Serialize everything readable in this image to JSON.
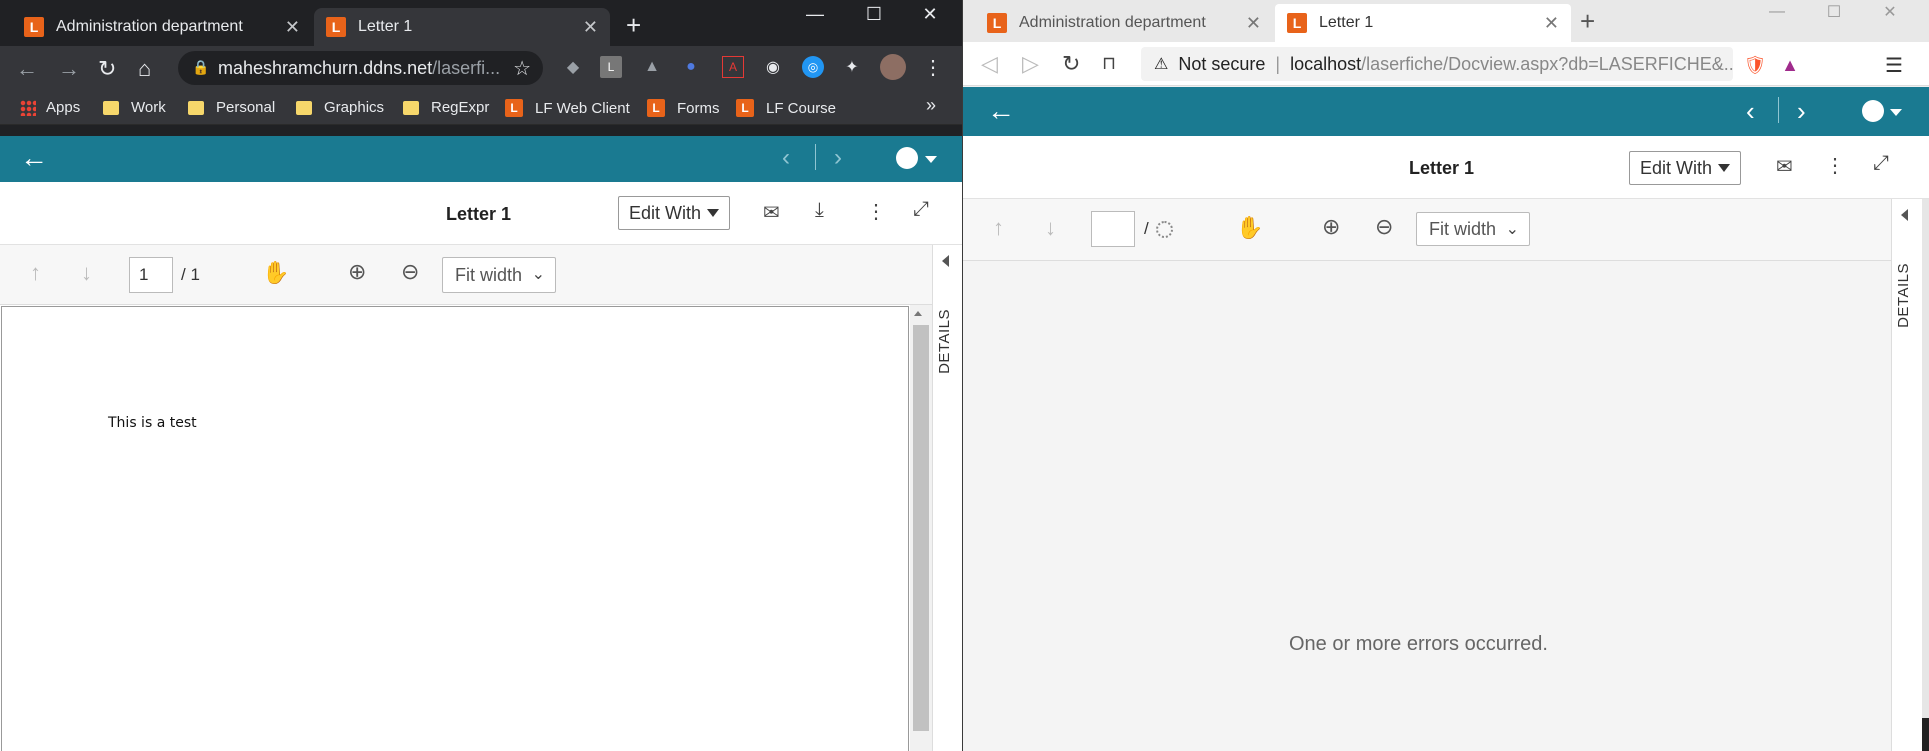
{
  "left_window": {
    "tabs": [
      {
        "title": "Administration department",
        "logo": "L"
      },
      {
        "title": "Letter 1",
        "logo": "L"
      }
    ],
    "window_controls": {
      "minimize": "—",
      "maximize": "☐",
      "close": "✕"
    },
    "url": {
      "host": "maheshramchurn.ddns.net",
      "path": "/laserfi..."
    },
    "bookmarks": [
      {
        "label": "Apps",
        "icon": "apps-grid-icon"
      },
      {
        "label": "Work",
        "icon": "folder-icon"
      },
      {
        "label": "Personal",
        "icon": "folder-icon"
      },
      {
        "label": "Graphics",
        "icon": "folder-icon"
      },
      {
        "label": "RegExpr",
        "icon": "folder-icon"
      },
      {
        "label": "LF Web Client",
        "icon": "laserfiche-icon"
      },
      {
        "label": "Forms",
        "icon": "laserfiche-icon"
      },
      {
        "label": "LF Course",
        "icon": "laserfiche-icon"
      }
    ],
    "bookmarks_overflow": "»",
    "viewer": {
      "title": "Letter 1",
      "edit_with": "Edit With",
      "page_current": "1",
      "page_total": "/ 1",
      "zoom": "Fit width",
      "details_label": "DETAILS",
      "document_text": "This is a test"
    }
  },
  "right_window": {
    "tabs": [
      {
        "title": "Administration department",
        "logo": "L"
      },
      {
        "title": "Letter 1",
        "logo": "L"
      }
    ],
    "window_controls": {
      "minimize": "—",
      "maximize": "☐",
      "close": "✕"
    },
    "security_label": "Not secure",
    "url": {
      "host": "localhost",
      "path": "/laserfiche/Docview.aspx?db=LASERFICHE&..."
    },
    "viewer": {
      "title": "Letter 1",
      "edit_with": "Edit With",
      "page_current": "",
      "page_total": "/",
      "zoom": "Fit width",
      "details_label": "DETAILS",
      "error_message": "One or more errors occurred."
    }
  },
  "colors": {
    "lf_teal": "#1a7a91",
    "lf_orange": "#e8631a",
    "chrome_dark": "#35363a"
  }
}
